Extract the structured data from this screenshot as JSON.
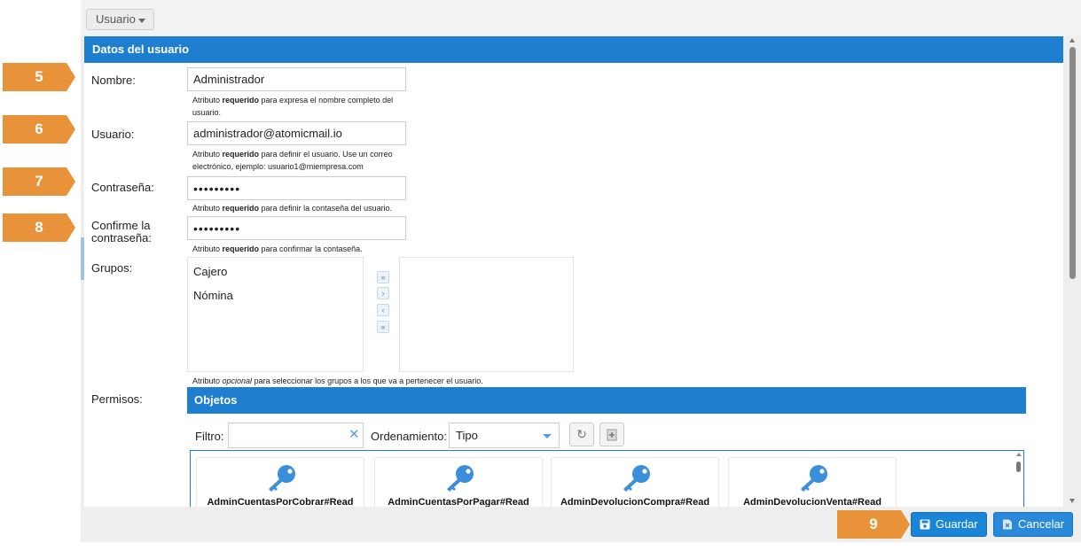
{
  "colors": {
    "accent": "#1e7fd0",
    "marker": "#e8923a",
    "link_blue": "#5a9bd8"
  },
  "top_menu": {
    "label": "Usuario"
  },
  "panel": {
    "title": "Datos del usuario"
  },
  "form": {
    "nombre": {
      "label": "Nombre:",
      "value": "Administrador",
      "help_pre": "Atributo ",
      "help_bold": "requerido",
      "help_post": " para expresa el nombre completo del usuario."
    },
    "usuario": {
      "label": "Usuario:",
      "value": "administrador@atomicmail.io",
      "help_pre": "Atributo ",
      "help_bold": "requerido",
      "help_post": " para definir el usuario. Use un correo electrónico, ejemplo: usuario1@miempresa.com"
    },
    "contrasena": {
      "label": "Contraseña:",
      "value": "•••••••••",
      "help_pre": "Atributo ",
      "help_bold": "requerido",
      "help_post": " para definir la contaseña del usuario."
    },
    "confirmar": {
      "label_line1": "Confirme la",
      "label_line2": "contraseña:",
      "value": "•••••••••",
      "help_pre": "Atributo ",
      "help_bold": "requerido",
      "help_post": " para confirmar la contaseña."
    },
    "grupos": {
      "label": "Grupos:",
      "available": [
        "Cajero",
        "Nómina"
      ],
      "help_pre": "Atributo ",
      "help_italic": "opcional",
      "help_post": " para seleccionar los grupos a los que va a pertenecer el usuario."
    },
    "permisos": {
      "label": "Permisos:"
    }
  },
  "objetos": {
    "title": "Objetos",
    "filter_label": "Filtro:",
    "filter_value": "",
    "sort_label": "Ordenamiento:",
    "sort_value": "Tipo",
    "items": [
      {
        "name": "AdminCuentasPorCobrar#Read",
        "icon": "key-icon"
      },
      {
        "name": "AdminCuentasPorPagar#Read",
        "icon": "key-icon"
      },
      {
        "name": "AdminDevolucionCompra#Read",
        "icon": "key-icon"
      },
      {
        "name": "AdminDevolucionVenta#Read",
        "icon": "key-icon"
      }
    ]
  },
  "buttons": {
    "save_label": "Guardar",
    "cancel_label": "Cancelar"
  },
  "markers": [
    "5",
    "6",
    "7",
    "8",
    "9"
  ]
}
